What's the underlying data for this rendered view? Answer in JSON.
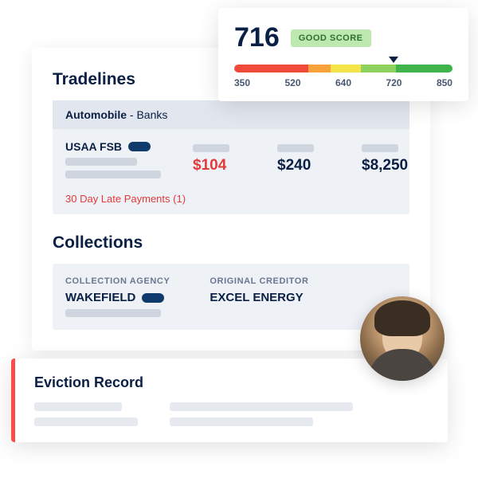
{
  "score": {
    "value": "716",
    "badge": "GOOD SCORE",
    "ticks": [
      "350",
      "520",
      "640",
      "720",
      "850"
    ]
  },
  "tradelines": {
    "title": "Tradelines",
    "category_bold": "Automobile",
    "category_rest": " - Banks",
    "creditor": "USAA FSB",
    "amounts": [
      "$104",
      "$240",
      "$8,250"
    ],
    "late_text": "30 Day Late Payments (1)"
  },
  "collections": {
    "title": "Collections",
    "agency_label": "COLLECTION AGENCY",
    "agency_value": "WAKEFIELD",
    "creditor_label": "ORIGINAL CREDITOR",
    "creditor_value": "EXCEL ENERGY"
  },
  "eviction": {
    "title": "Eviction Record"
  }
}
